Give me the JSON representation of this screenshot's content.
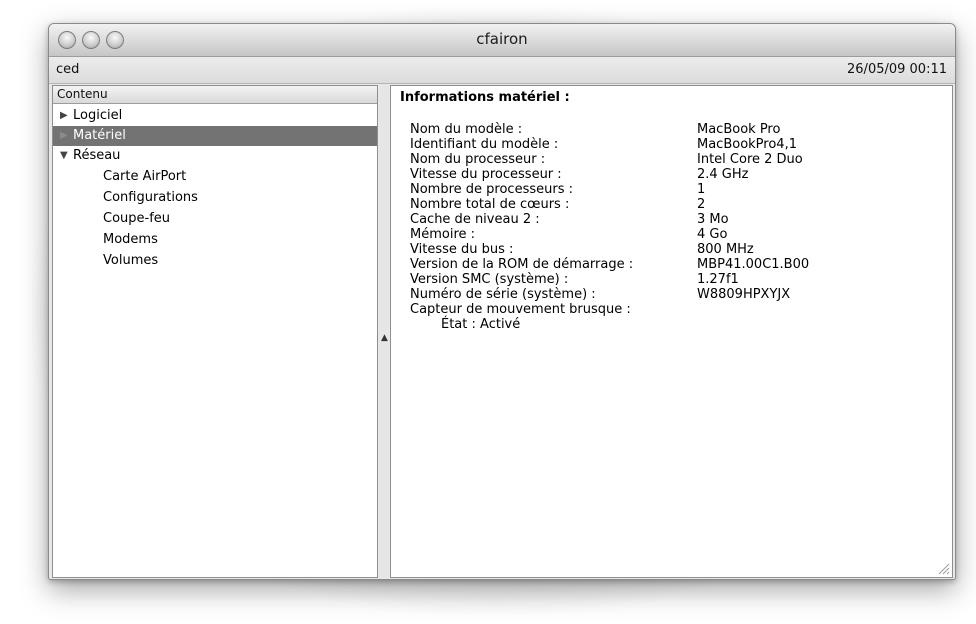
{
  "window": {
    "title": "cfairon"
  },
  "infobar": {
    "user": "ced",
    "datetime": "26/05/09 00:11"
  },
  "sidebar": {
    "header": "Contenu",
    "items": [
      {
        "label": "Logiciel",
        "expander": "▶",
        "level": 0,
        "selected": false
      },
      {
        "label": "Matériel",
        "expander": "▶",
        "level": 0,
        "selected": true
      },
      {
        "label": "Réseau",
        "expander": "▼",
        "level": 0,
        "selected": false
      },
      {
        "label": "Carte AirPort",
        "level": 1,
        "selected": false
      },
      {
        "label": "Configurations",
        "level": 1,
        "selected": false
      },
      {
        "label": "Coupe-feu",
        "level": 1,
        "selected": false
      },
      {
        "label": "Modems",
        "level": 1,
        "selected": false
      },
      {
        "label": "Volumes",
        "level": 1,
        "selected": false
      }
    ]
  },
  "detail": {
    "title": "Informations matériel :",
    "rows": [
      {
        "key": "Nom du modèle :",
        "value": "MacBook Pro"
      },
      {
        "key": "Identifiant du modèle :",
        "value": "MacBookPro4,1"
      },
      {
        "key": "Nom du processeur :",
        "value": "Intel Core 2 Duo"
      },
      {
        "key": "Vitesse du processeur :",
        "value": "2.4 GHz"
      },
      {
        "key": "Nombre de processeurs :",
        "value": "1"
      },
      {
        "key": "Nombre total de cœurs :",
        "value": "2"
      },
      {
        "key": "Cache de niveau 2 :",
        "value": "3 Mo"
      },
      {
        "key": "Mémoire :",
        "value": "4 Go"
      },
      {
        "key": "Vitesse du bus :",
        "value": "800 MHz"
      },
      {
        "key": "Version de la ROM de démarrage :",
        "value": "MBP41.00C1.B00"
      },
      {
        "key": "Version SMC (système) :",
        "value": "1.27f1"
      },
      {
        "key": "Numéro de série (système) :",
        "value": "W8809HPXYJX"
      },
      {
        "key": "Capteur de mouvement brusque :",
        "value": ""
      }
    ],
    "sub_row": {
      "key": "État :",
      "value": "Activé"
    }
  },
  "colors": {
    "selection": "#737373",
    "titlebar": "#c6c6c6"
  },
  "icons": [
    "close-button-icon",
    "minimize-button-icon",
    "zoom-button-icon",
    "disclosure-triangle-icon",
    "splitter-grip-icon",
    "resize-grip-icon"
  ]
}
